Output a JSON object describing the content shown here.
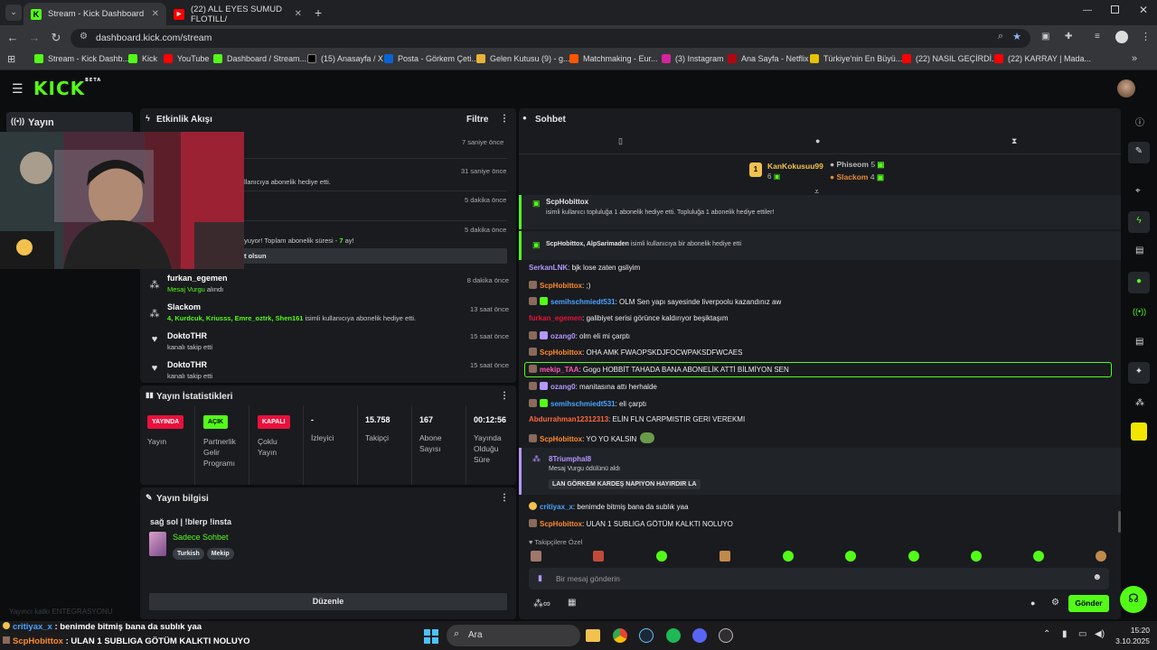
{
  "browser": {
    "tabs": [
      {
        "title": "Stream - Kick Dashboard",
        "favicon": "kick",
        "active": true
      },
      {
        "title": "(22) ALL EYES SUMUD FLOTILL/",
        "favicon": "youtube",
        "active": false
      }
    ],
    "url": "dashboard.kick.com/stream",
    "bookmarks": [
      "Stream - Kick Dashb...",
      "Kick",
      "YouTube",
      "Dashboard / Stream...",
      "(15) Anasayfa / X",
      "Posta - Görkem Çeti...",
      "Gelen Kutusu (9) - g...",
      "Matchmaking - Eur...",
      "(3) Instagram",
      "Ana Sayfa - Netflix",
      "Türkiye'nin En Büyü...",
      "(22) NASIL GEÇİRDİ...",
      "(22) KARRAY | Mada..."
    ]
  },
  "kick": {
    "logo": "KICK",
    "logo_sup": "BETA",
    "sidebar": {
      "stream_label": "Yayın"
    },
    "ticker_faded": "Yayıncı katkı ENTEGRASYONU"
  },
  "activity": {
    "title": "Etkinlik Akışı",
    "filter_label": "Filtre",
    "partial_rows": [
      {
        "time": "7 saniye önce"
      },
      {
        "desc_tail": "llanıcıya abonelik hediye etti.",
        "time": "31 saniye önce"
      },
      {
        "time": "5 dakika önce"
      },
      {
        "desc_tail": "yuyor! Toplam abonelik süresi - ",
        "months": "7",
        "suffix": " ay!",
        "time": "5 dakika önce"
      },
      {
        "desc_tail": "t olsun"
      }
    ],
    "events": [
      {
        "name": "furkan_egemen",
        "desc_green": "Mesaj Vurgu",
        "desc": " alındı",
        "time": "8 dakika önce",
        "icon": "sparkle-icon"
      },
      {
        "name": "Slackom",
        "desc_green": "4, Kurdcuk, Kriusss, Emre_oztrk, Shen161",
        "desc": " isimli kullanıcıya abonelik hediye etti.",
        "time": "13 saat önce",
        "icon": "gift-icon"
      },
      {
        "name": "DoktoTHR",
        "desc_green": "",
        "desc": "kanalı takip etti",
        "time": "15 saat önce",
        "icon": "heart-icon"
      },
      {
        "name": "DoktoTHR",
        "desc_green": "",
        "desc": "kanalı takip etti",
        "time": "15 saat önce",
        "icon": "heart-icon"
      }
    ]
  },
  "stats": {
    "title": "Yayın İstatistikleri",
    "badges": [
      {
        "label": "YAYINDA",
        "color": "#e9113c",
        "caption": "Yayın"
      },
      {
        "label": "AÇIK",
        "color": "#53fc18",
        "caption": "Partnerlik Gelir Programı"
      },
      {
        "label": "KAPALI",
        "color": "#e9113c",
        "caption": "Çoklu Yayın"
      }
    ],
    "values": [
      {
        "value": "-",
        "caption": "İzleyici"
      },
      {
        "value": "15.758",
        "caption": "Takipçi"
      },
      {
        "value": "167",
        "caption": "Abone Sayısı"
      },
      {
        "value": "00:12:56",
        "caption": "Yayında Olduğu Süre"
      }
    ]
  },
  "stream_info": {
    "title": "Yayın bilgisi",
    "stream_title": "sağ sol | !blerp !insta",
    "category": "Sadece Sohbet",
    "tags": [
      "Turkish",
      "Mekip"
    ],
    "edit_label": "Düzenle"
  },
  "chat": {
    "title": "Sohbet",
    "leaderboard": {
      "first": {
        "name": "KanKokusuu99",
        "count": "6",
        "rank": "1"
      },
      "second": {
        "name": "Phiseom",
        "count": "5"
      },
      "third": {
        "name": "Slackom",
        "count": "4"
      }
    },
    "gift1": {
      "user": "ScpHobittox",
      "text": "isimli kullanıcı topluluğa 1 abonelik hediye etti. Topluluğa 1 abonelik hediye ettiler!"
    },
    "gift2": {
      "user": "ScpHobittox, AlpSarimaden",
      "text": " isimli kullanıcıya bir abonelik hediye etti"
    },
    "messages": [
      {
        "user": "SerkanLNK",
        "color": "#b497ff",
        "text": ": bjk lose zaten gsliyim",
        "icon": ""
      },
      {
        "user": "ScpHobittox",
        "color": "#ff8a2b",
        "text": ": ;)",
        "icon": "avatar"
      },
      {
        "user": "semihschmiedt531",
        "color": "#4aa3ff",
        "text": ": OLM Sen yapı sayesinde liverpoolu kazandınız aw",
        "icon": "sub"
      },
      {
        "user": "furkan_egemen",
        "color": "#e9113c",
        "text": ": galibiyet serisi görünce kaldırıyor beşiktaşım",
        "icon": ""
      },
      {
        "user": "ozang0",
        "color": "#b497ff",
        "text": ": olm eli mi çarptı",
        "icon": "sub"
      },
      {
        "user": "ScpHobittox",
        "color": "#ff8a2b",
        "text": ": OHA AMK FWAOPSKDJFOCWPAKSDFWCAES",
        "icon": "avatar"
      },
      {
        "user": "mekip_TAA",
        "color": "#ff5ab4",
        "text": ": Gogo HOBBİT TAHADA BANA ABONELİK ATTİ BİLMİYON SEN",
        "icon": "avatar",
        "highlight": true
      },
      {
        "user": "ozang0",
        "color": "#b497ff",
        "text": ": manitasına attı herhalde",
        "icon": "sub"
      },
      {
        "user": "semihschmiedt531",
        "color": "#4aa3ff",
        "text": ": eli çarptı",
        "icon": "sub"
      },
      {
        "user": "Abdurrahman12312313",
        "color": "#ff6a3d",
        "text": ": ELİN FLN CARPMISTIR GERI VEREKMI",
        "icon": ""
      },
      {
        "user": "ScpHobittox",
        "color": "#ff8a2b",
        "text": ": YO YO KALSIN",
        "icon": "avatar"
      }
    ],
    "redeem": {
      "user": "8Triumphal8",
      "desc": "Mesaj Vurgu ödülünü aldı",
      "message": "LAN GÖRKEM KARDEŞ NAPIYON HAYIRDIR LA"
    },
    "late_messages": [
      {
        "user": "critiyax_x",
        "color": "#4aa3ff",
        "text": ": benimde bitmiş bana da sublık yaa"
      },
      {
        "user": "ScpHobittox",
        "color": "#ff8a2b",
        "text": ": ULAN 1 SUBLIGA GÖTÜM KALKTI NOLUYO"
      }
    ],
    "followers_only": "Takipçilere Özel",
    "input_placeholder": "Bir mesaj gönderin",
    "send_label": "Gönder"
  },
  "overlay_chat": [
    {
      "user": "critiyax_x",
      "text": " : benimde bitmiş bana da sublık yaa"
    },
    {
      "user": "ScpHobittox",
      "text": " : ULAN 1 SUBLIGA GÖTÜM KALKTI NOLUYO"
    }
  ],
  "taskbar": {
    "search": "Ara",
    "time": "15:20",
    "date": "3.10.2025"
  },
  "colors": {
    "brand": "#53fc18",
    "panel": "#191b1f",
    "live": "#e9113c"
  }
}
